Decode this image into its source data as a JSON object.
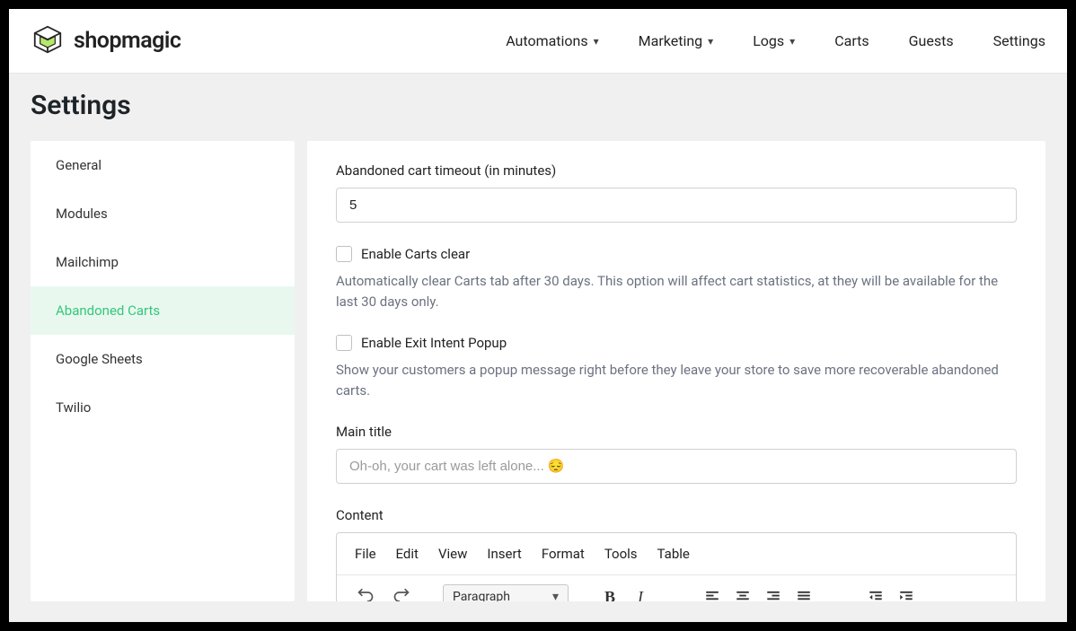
{
  "brand": "shopmagic",
  "nav": {
    "automations": "Automations",
    "marketing": "Marketing",
    "logs": "Logs",
    "carts": "Carts",
    "guests": "Guests",
    "settings": "Settings"
  },
  "page_title": "Settings",
  "sidebar": {
    "items": [
      {
        "label": "General"
      },
      {
        "label": "Modules"
      },
      {
        "label": "Mailchimp"
      },
      {
        "label": "Abandoned Carts"
      },
      {
        "label": "Google Sheets"
      },
      {
        "label": "Twilio"
      }
    ]
  },
  "form": {
    "timeout_label": "Abandoned cart timeout (in minutes)",
    "timeout_value": "5",
    "enable_clear_label": "Enable Carts clear",
    "enable_clear_help": "Automatically clear Carts tab after 30 days. This option will affect cart statistics, at they will be available for the last 30 days only.",
    "enable_exit_label": "Enable Exit Intent Popup",
    "enable_exit_help": "Show your customers a popup message right before they leave your store to save more recoverable abandoned carts.",
    "main_title_label": "Main title",
    "main_title_placeholder": "Oh-oh, your cart was left alone... 😔",
    "content_label": "Content"
  },
  "editor": {
    "menu": {
      "file": "File",
      "edit": "Edit",
      "view": "View",
      "insert": "Insert",
      "format": "Format",
      "tools": "Tools",
      "table": "Table"
    },
    "block_select": "Paragraph"
  }
}
